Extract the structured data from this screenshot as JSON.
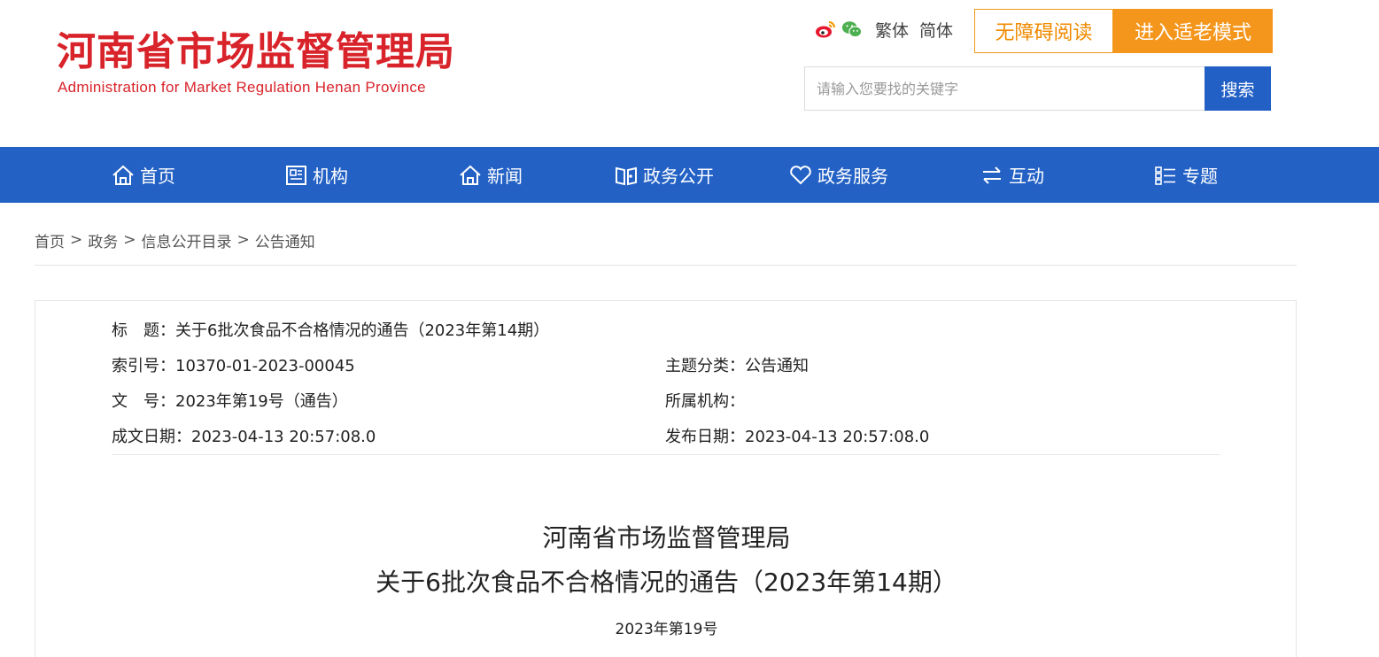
{
  "header": {
    "logo_cn": "河南省市场监督管理局",
    "logo_en": "Administration for Market Regulation Henan Province",
    "lang_traditional": "繁体",
    "lang_simplified": "简体",
    "accessible_label": "无障碍阅读",
    "elder_mode_label": "进入适老模式",
    "search": {
      "placeholder": "请输入您要找的关键字",
      "button_label": "搜索"
    },
    "icons": [
      "weibo-icon",
      "wechat-icon"
    ]
  },
  "colors": {
    "brand_red": "#d8232a",
    "nav_blue": "#2361c5",
    "accent_orange": "#f5961c"
  },
  "nav": {
    "items": [
      {
        "label": "首页",
        "icon": "home-icon"
      },
      {
        "label": "机构",
        "icon": "org-icon"
      },
      {
        "label": "新闻",
        "icon": "home-icon"
      },
      {
        "label": "政务公开",
        "icon": "book-icon"
      },
      {
        "label": "政务服务",
        "icon": "heart-icon"
      },
      {
        "label": "互动",
        "icon": "exchange-icon"
      },
      {
        "label": "专题",
        "icon": "list-icon"
      }
    ]
  },
  "breadcrumb": {
    "items": [
      "首页",
      "政务",
      "信息公开目录",
      "公告通知"
    ],
    "sep": ">"
  },
  "meta": {
    "title_label": "标　题：",
    "title_value": "关于6批次食品不合格情况的通告（2023年第14期）",
    "index_label": "索引号：",
    "index_value": "10370-01-2023-00045",
    "topic_label": "主题分类：",
    "topic_value": "公告通知",
    "docno_label": "文　号：",
    "docno_value": "2023年第19号（通告）",
    "org_label": "所属机构：",
    "org_value": "",
    "created_label": "成文日期：",
    "created_value": "2023-04-13 20:57:08.0",
    "published_label": "发布日期：",
    "published_value": "2023-04-13 20:57:08.0"
  },
  "doc": {
    "title_line1": "河南省市场监督管理局",
    "title_line2": "关于6批次食品不合格情况的通告（2023年第14期）",
    "number": "2023年第19号"
  }
}
